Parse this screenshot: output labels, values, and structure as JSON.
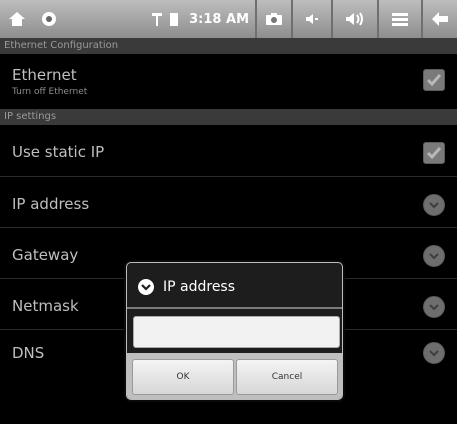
{
  "statusbar": {
    "time": "3:18 AM",
    "icons": [
      "home-icon",
      "circle-icon",
      "signal-icon",
      "battery-icon",
      "camera-icon",
      "volume-down-icon",
      "volume-up-icon",
      "menu-icon",
      "back-icon"
    ]
  },
  "sections": {
    "ethernet_header": "Ethernet Configuration",
    "ip_header": "IP settings"
  },
  "ethernet": {
    "label": "Ethernet",
    "summary": "Turn off Ethernet",
    "checked": true
  },
  "use_static": {
    "label": "Use static IP",
    "checked": true
  },
  "items": [
    {
      "label": "IP address"
    },
    {
      "label": "Gateway"
    },
    {
      "label": "Netmask"
    },
    {
      "label": "DNS"
    }
  ],
  "dialog": {
    "title": "IP address",
    "input_value": "",
    "ok_label": "OK",
    "cancel_label": "Cancel"
  }
}
